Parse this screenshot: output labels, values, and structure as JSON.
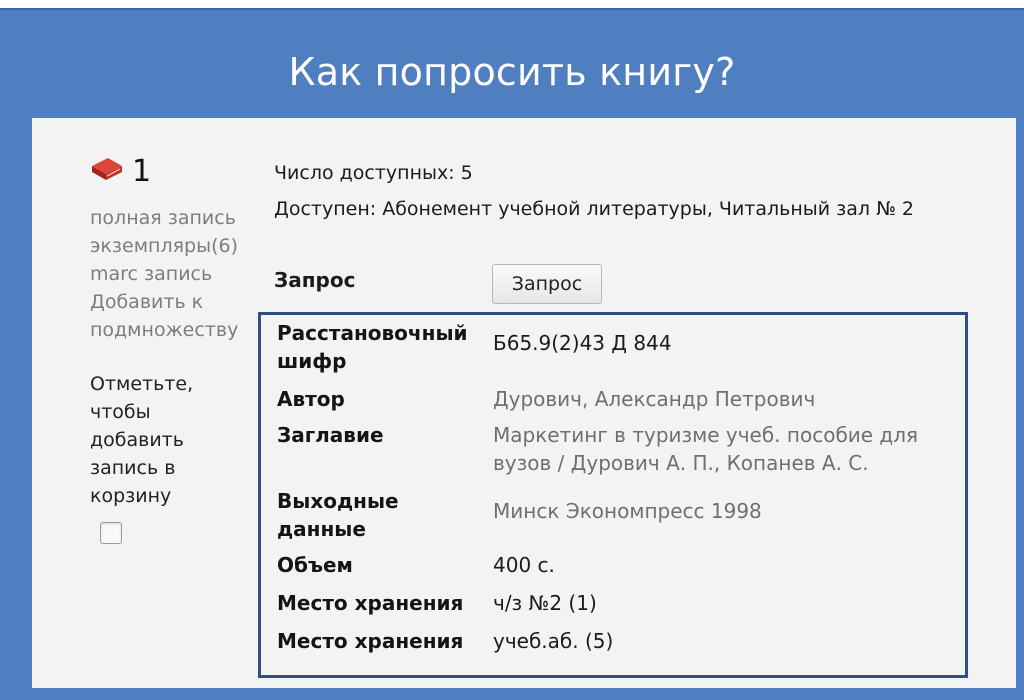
{
  "header": {
    "title": "Как попросить книгу?"
  },
  "record": {
    "number": "1",
    "links": [
      "полная запись",
      "экземпляры(6)",
      "marc запись",
      "Добавить к подмножеству"
    ],
    "mark_text": "Отметьте, чтобы добавить запись в корзину",
    "cart_checked": false
  },
  "availability": {
    "count_text": "Число доступных: 5",
    "where_text": "Доступен: Абонемент учебной литературы, Читальный зал № 2"
  },
  "request": {
    "label": "Запрос",
    "button_label": "Запрос"
  },
  "details": [
    {
      "label": "Расстановочный шифр",
      "value": "Б65.9(2)43 Д 844"
    },
    {
      "label": "Автор",
      "value": "Дурович, Александр Петрович"
    },
    {
      "label": "Заглавие",
      "value": "Маркетинг в туризме учеб. пособие для вузов / Дурович А. П., Копанев А. С."
    },
    {
      "label": "Выходные данные",
      "value": "Минск Экономпресс 1998"
    },
    {
      "label": "Объем",
      "value": "400 с."
    },
    {
      "label": "Место хранения",
      "value": "ч/з №2 (1)"
    },
    {
      "label": "Место хранения",
      "value": "учеб.аб. (5)"
    }
  ],
  "colors": {
    "frame": "#4f7fc0",
    "panel": "#f3f3f3",
    "details_border": "#2d4f86",
    "book_icon": "#d0322c"
  },
  "icons": {
    "record": "book-icon"
  }
}
